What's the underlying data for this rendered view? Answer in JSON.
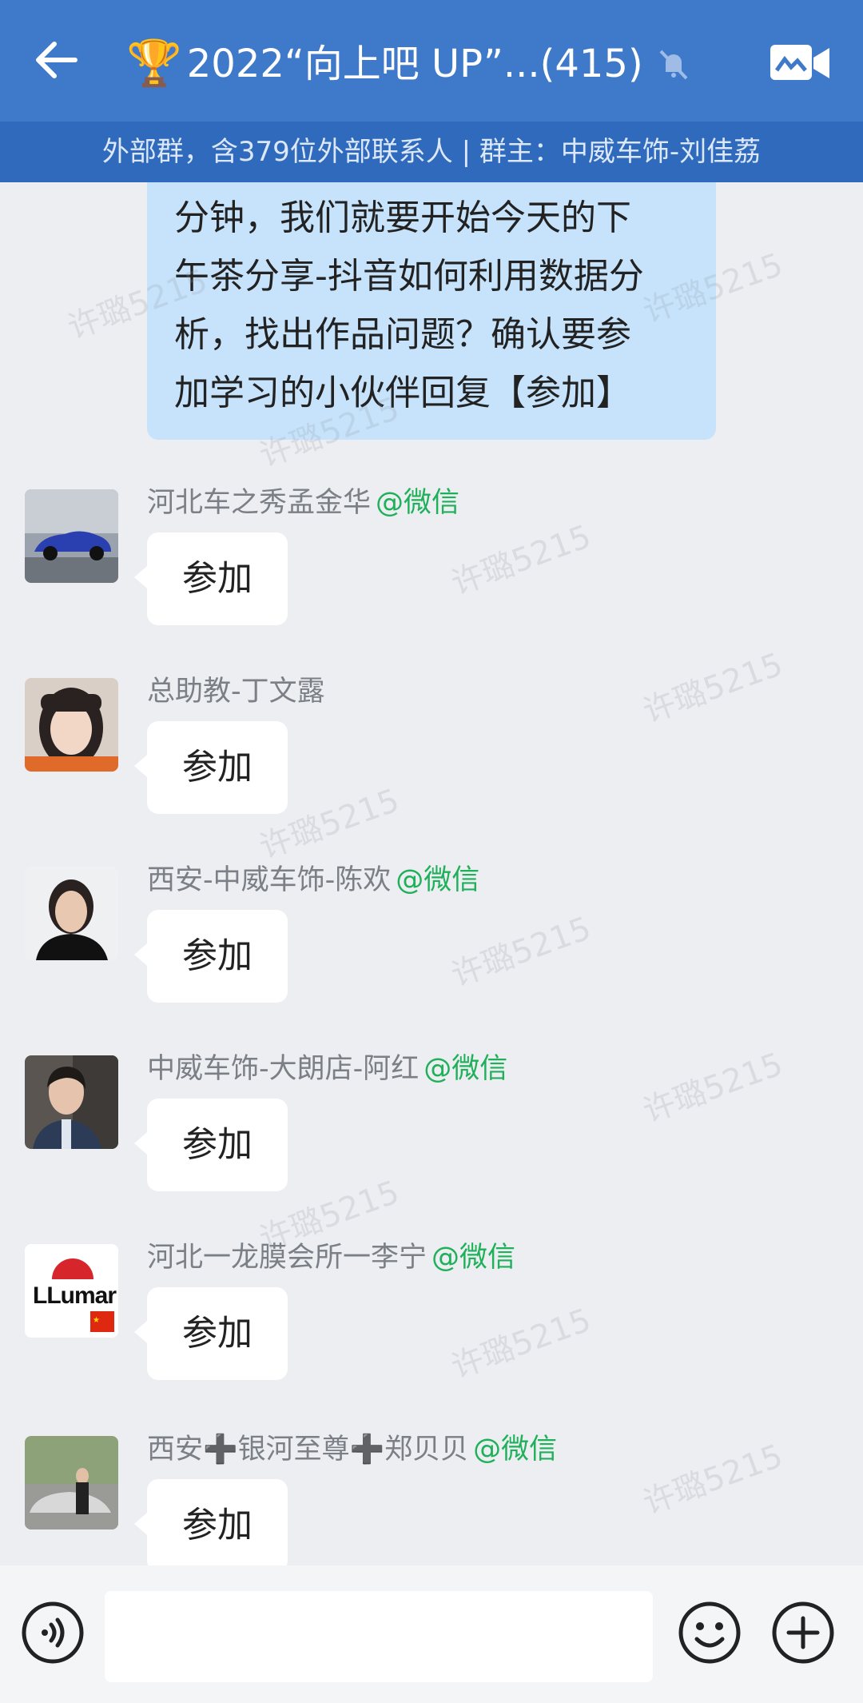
{
  "header": {
    "title": "2022“向上吧 UP”...(415)",
    "trophy_icon": "🏆",
    "subtitle": "外部群，含379位外部联系人 | 群主：中威车饰-刘佳荔"
  },
  "own_message": {
    "lines": [
      "分钟，我们就要开始今天的下",
      "午茶分享-抖音如何利用数据分",
      "析，找出作品问题？确认要参",
      "加学习的小伙伴回复【参加】"
    ]
  },
  "messages": [
    {
      "sender": "河北车之秀孟金华",
      "tag": "@微信",
      "text": "参加"
    },
    {
      "sender": "总助教-丁文露",
      "tag": "",
      "text": "参加"
    },
    {
      "sender": "西安-中威车饰-陈欢",
      "tag": "@微信",
      "text": "参加"
    },
    {
      "sender": "中威车饰-大朗店-阿红",
      "tag": "@微信",
      "text": "参加"
    },
    {
      "sender": "河北一龙膜会所一李宁",
      "tag": "@微信",
      "text": "参加"
    },
    {
      "sender": "西安➕银河至尊➕郑贝贝",
      "tag": "@微信",
      "text": "参加"
    }
  ],
  "watermark": "许璐5215",
  "avatar_logo_text": "LLumar",
  "colors": {
    "header": "#3f79c9",
    "subbar": "#2f6abc",
    "own_bubble": "#c6e3fb",
    "wechat_tag": "#1fb05a"
  }
}
